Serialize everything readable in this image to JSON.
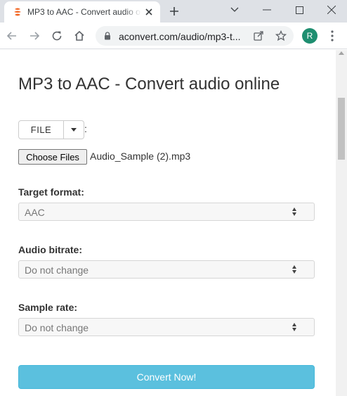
{
  "browser": {
    "tab": {
      "title": "MP3 to AAC - Convert audio online"
    },
    "address_bar": {
      "url": "aconvert.com/audio/mp3-t..."
    },
    "profile": {
      "initial": "R"
    }
  },
  "page": {
    "heading": "MP3 to AAC - Convert audio online",
    "file_source": {
      "button_label": "FILE",
      "colon": ":"
    },
    "file_input": {
      "button_label": "Choose Files",
      "chosen_file": "Audio_Sample (2).mp3"
    },
    "fields": [
      {
        "label": "Target format:",
        "value": "AAC"
      },
      {
        "label": "Audio bitrate:",
        "value": "Do not change"
      },
      {
        "label": "Sample rate:",
        "value": "Do not change"
      }
    ],
    "convert_button": "Convert Now!"
  },
  "colors": {
    "accent_button": "#5bc0de",
    "tab_strip": "#dee1e6",
    "avatar": "#1e8e70"
  },
  "icons": [
    "app-favicon-icon",
    "close-icon",
    "plus-icon",
    "chevron-down-icon",
    "minimize-icon",
    "maximize-icon",
    "back-arrow-icon",
    "forward-arrow-icon",
    "reload-icon",
    "home-icon",
    "lock-icon",
    "share-icon",
    "star-icon",
    "kebab-menu-icon",
    "caret-down-icon",
    "select-arrows-icon"
  ]
}
